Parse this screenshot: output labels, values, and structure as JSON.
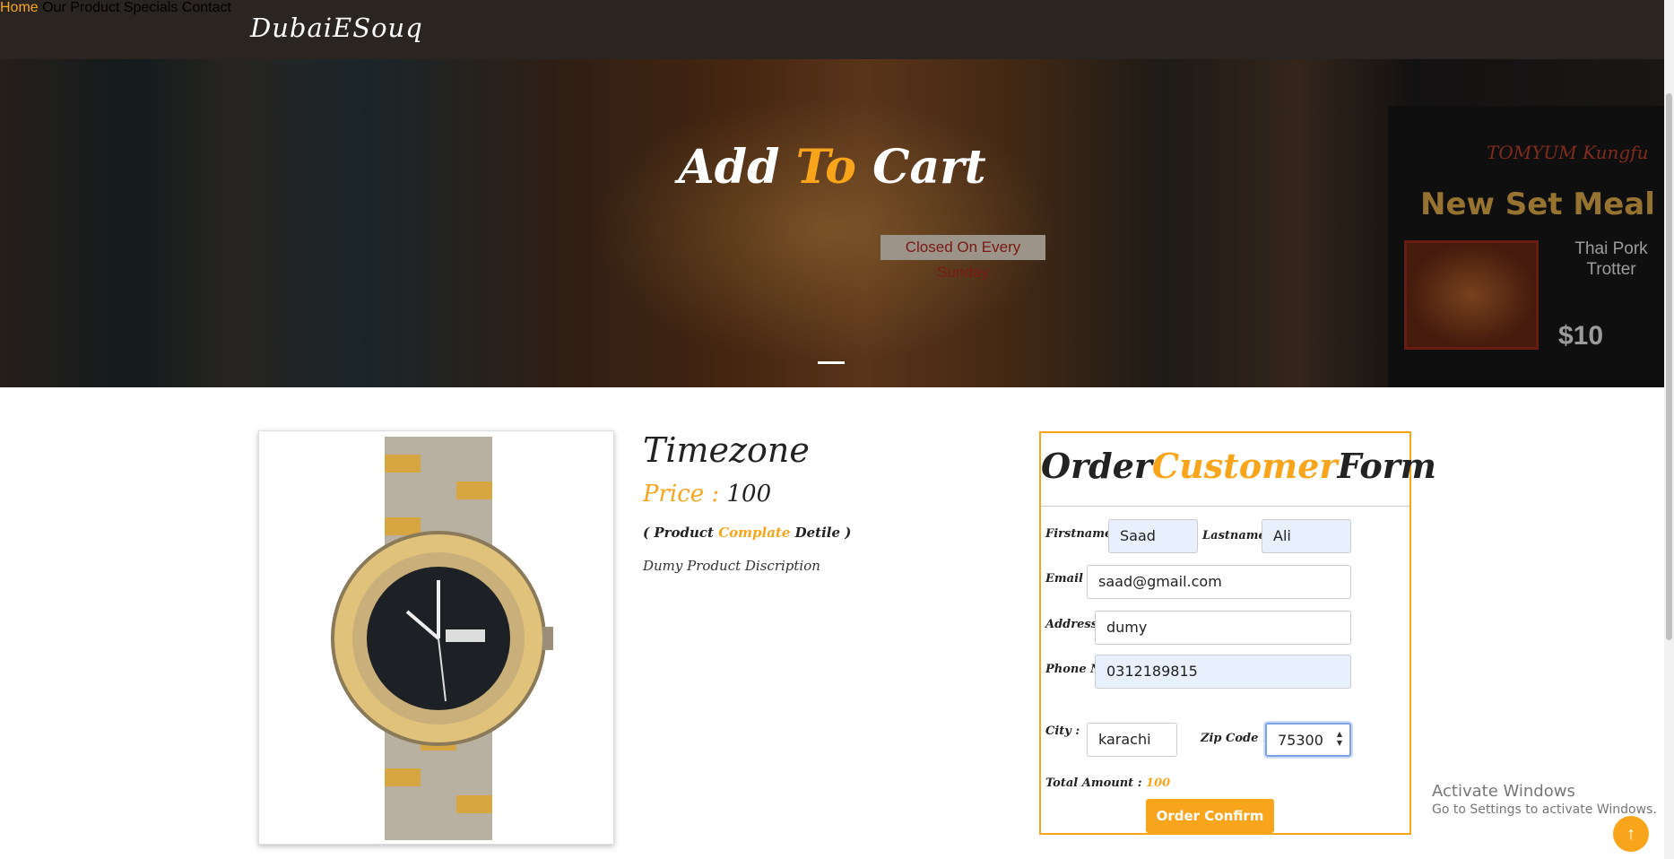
{
  "brand": "DubaiESouq",
  "nav": [
    {
      "label": "Home",
      "active": true
    },
    {
      "label": "Our Product",
      "active": false
    },
    {
      "label": "Specials",
      "active": false
    },
    {
      "label": "Contact",
      "active": false
    }
  ],
  "hero": {
    "title_part1": "Add ",
    "title_accent": "To",
    "title_part2": " Cart",
    "sign_brand": "TOMYUM Kungfu",
    "sign_headline": "New Set Meal",
    "sign_item": "Thai Pork Trotter",
    "sign_price": "$10",
    "closed_sign": "Closed On Every Sunday"
  },
  "product": {
    "name": "Timezone",
    "price_label": "Price : ",
    "price_value": "100",
    "detail_open": "( Product ",
    "detail_accent": "Complate",
    "detail_close": " Detile )",
    "description": "Dumy Product Discription"
  },
  "form": {
    "title_part1": "Order",
    "title_accent": "Customer",
    "title_part2": "Form",
    "firstname_label": "Firstname :",
    "firstname_value": "Saad",
    "lastname_label": "Lastname :",
    "lastname_value": "Ali",
    "email_label": "Email :",
    "email_value": "saad@gmail.com",
    "address_label": "Address:",
    "address_value": "dumy",
    "phone_label": "Phone No",
    "phone_value": "0312189815",
    "city_label": "City :",
    "city_value": "karachi",
    "zip_label": "Zip Code :",
    "zip_value": "75300",
    "total_label": "Total Amount : ",
    "total_value": "100",
    "confirm_label": "Order Confirm"
  },
  "watermark": {
    "line1": "Activate Windows",
    "line2": "Go to Settings to activate Windows."
  },
  "colors": {
    "accent": "#f8a51c",
    "navbar": "#2a2520"
  }
}
